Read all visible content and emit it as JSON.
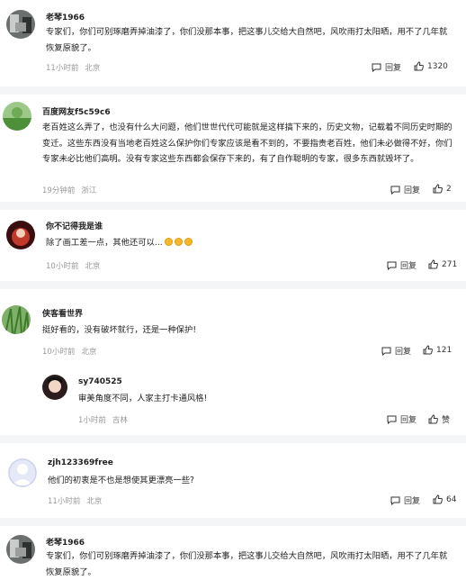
{
  "comments": [
    {
      "user": "老琴1966",
      "text": "专家们，你们可别琢磨弄掉油漆了，你们没那本事，把这事儿交给大自然吧，风吹雨打太阳晒，用不了几年就恢复原貌了。",
      "time": "11小时前",
      "location": "北京",
      "reply_label": "回复",
      "likes": "1320"
    },
    {
      "user": "百度网友f5c59c6",
      "text": "老百姓这么弄了，也没有什么大问题，他们世世代代可能就是这样搞下来的，历史文物，记载着不同历史时期的变迁。这些东西没有当地老百姓这么保护你们专家应该是看不到的，不要指责老百姓，他们未必做得不好，你们专家未必比他们高明。没有专家这些东西都会保存下来的，有了自作聪明的专家，很多东西就毁坏了。",
      "time": "19分钟前",
      "location": "浙江",
      "reply_label": "回复",
      "likes": "2"
    },
    {
      "user": "你不记得我是谁",
      "text": "除了画工差一点，其他还可以...",
      "time": "10小时前",
      "location": "北京",
      "reply_label": "回复",
      "likes": "271"
    },
    {
      "user": "侠客看世界",
      "text": "挺好看的，没有破坏就行，还是一种保护!",
      "time": "10小时前",
      "location": "北京",
      "reply_label": "回复",
      "likes": "121",
      "reply": {
        "user": "sy740525",
        "text": "审美角度不同，人家主打卡通风格!",
        "time": "1小时前",
        "location": "吉林",
        "reply_label": "回复",
        "likes": "赞"
      }
    },
    {
      "user": "zjh123369free",
      "text": "他们的初衷是不也是想使其更漂亮一些?",
      "time": "11小时前",
      "location": "北京",
      "reply_label": "回复",
      "likes": "64"
    },
    {
      "user": "老琴1966",
      "text": "专家们，你们可别琢磨弄掉油漆了，你们没那本事，把这事儿交给大自然吧，风吹雨打太阳晒，用不了几年就恢复原貌了。"
    }
  ]
}
